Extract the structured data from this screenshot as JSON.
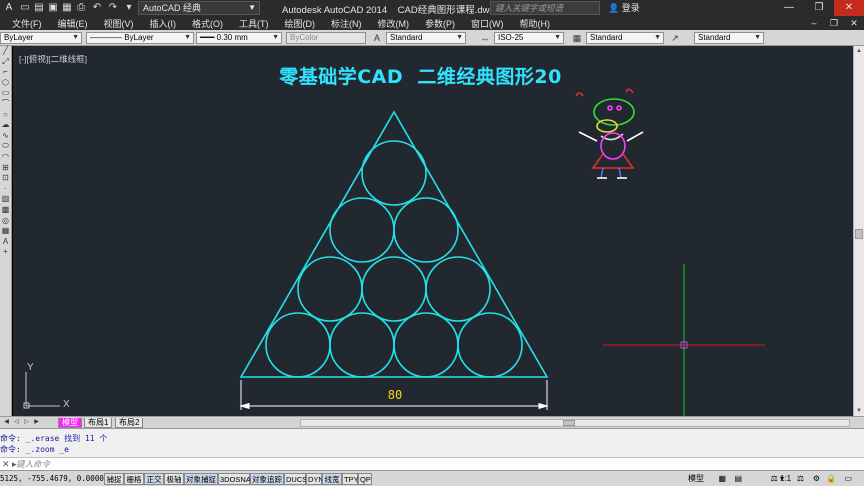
{
  "titlebar": {
    "workspace": "AutoCAD 经典",
    "app_title": "Autodesk AutoCAD 2014    CAD经典图形课程.dwg",
    "search_placeholder": "键入关键字或短语",
    "login": "登录",
    "controls": [
      "—",
      "❐",
      "✕"
    ]
  },
  "menu": {
    "items": [
      "文件(F)",
      "编辑(E)",
      "视图(V)",
      "插入(I)",
      "格式(O)",
      "工具(T)",
      "绘图(D)",
      "标注(N)",
      "修改(M)",
      "参数(P)",
      "窗口(W)",
      "帮助(H)"
    ]
  },
  "properties_bar": {
    "layer": "ByLayer",
    "linetype": "ByLayer",
    "lineweight": "0.30 mm",
    "color": "ByColor",
    "text_style": "Standard",
    "dim_style": "ISO-25",
    "table_style": "Standard",
    "multileader_style": "Standard"
  },
  "canvas": {
    "view_label": "[-][俯视][二维线框]",
    "title": "零基础学CAD  二维经典图形20",
    "dimension_value": "80",
    "ucs": {
      "x": "X",
      "y": "Y"
    },
    "colors": {
      "background": "#212830",
      "geometry": "#25e0e6",
      "dimension": "#ffffff",
      "dimension_text": "#ffd21e",
      "crosshair_h": "#e01818",
      "crosshair_v": "#18c818"
    }
  },
  "tabs": {
    "items": [
      {
        "label": "模型",
        "active": true
      },
      {
        "label": "布局1",
        "active": false
      },
      {
        "label": "布局2",
        "active": false
      }
    ]
  },
  "command": {
    "history": [
      "命令: _.erase 找到 11 个",
      "命令: _.zoom _e"
    ],
    "input_placeholder": "键入命令"
  },
  "statusbar": {
    "coords": "5125, -755.4679, 0.0000",
    "toggles": [
      {
        "label": "捕捉",
        "on": false
      },
      {
        "label": "栅格",
        "on": false
      },
      {
        "label": "正交",
        "on": true
      },
      {
        "label": "极轴",
        "on": false
      },
      {
        "label": "对象捕捉",
        "on": true
      },
      {
        "label": "3DOSNAP",
        "on": false
      },
      {
        "label": "对象追踪",
        "on": true
      },
      {
        "label": "DUCS",
        "on": false
      },
      {
        "label": "DYN",
        "on": false
      },
      {
        "label": "线宽",
        "on": true
      },
      {
        "label": "TPY",
        "on": false
      },
      {
        "label": "QP",
        "on": false
      }
    ],
    "model_label": "模型",
    "scale": "1:1"
  }
}
